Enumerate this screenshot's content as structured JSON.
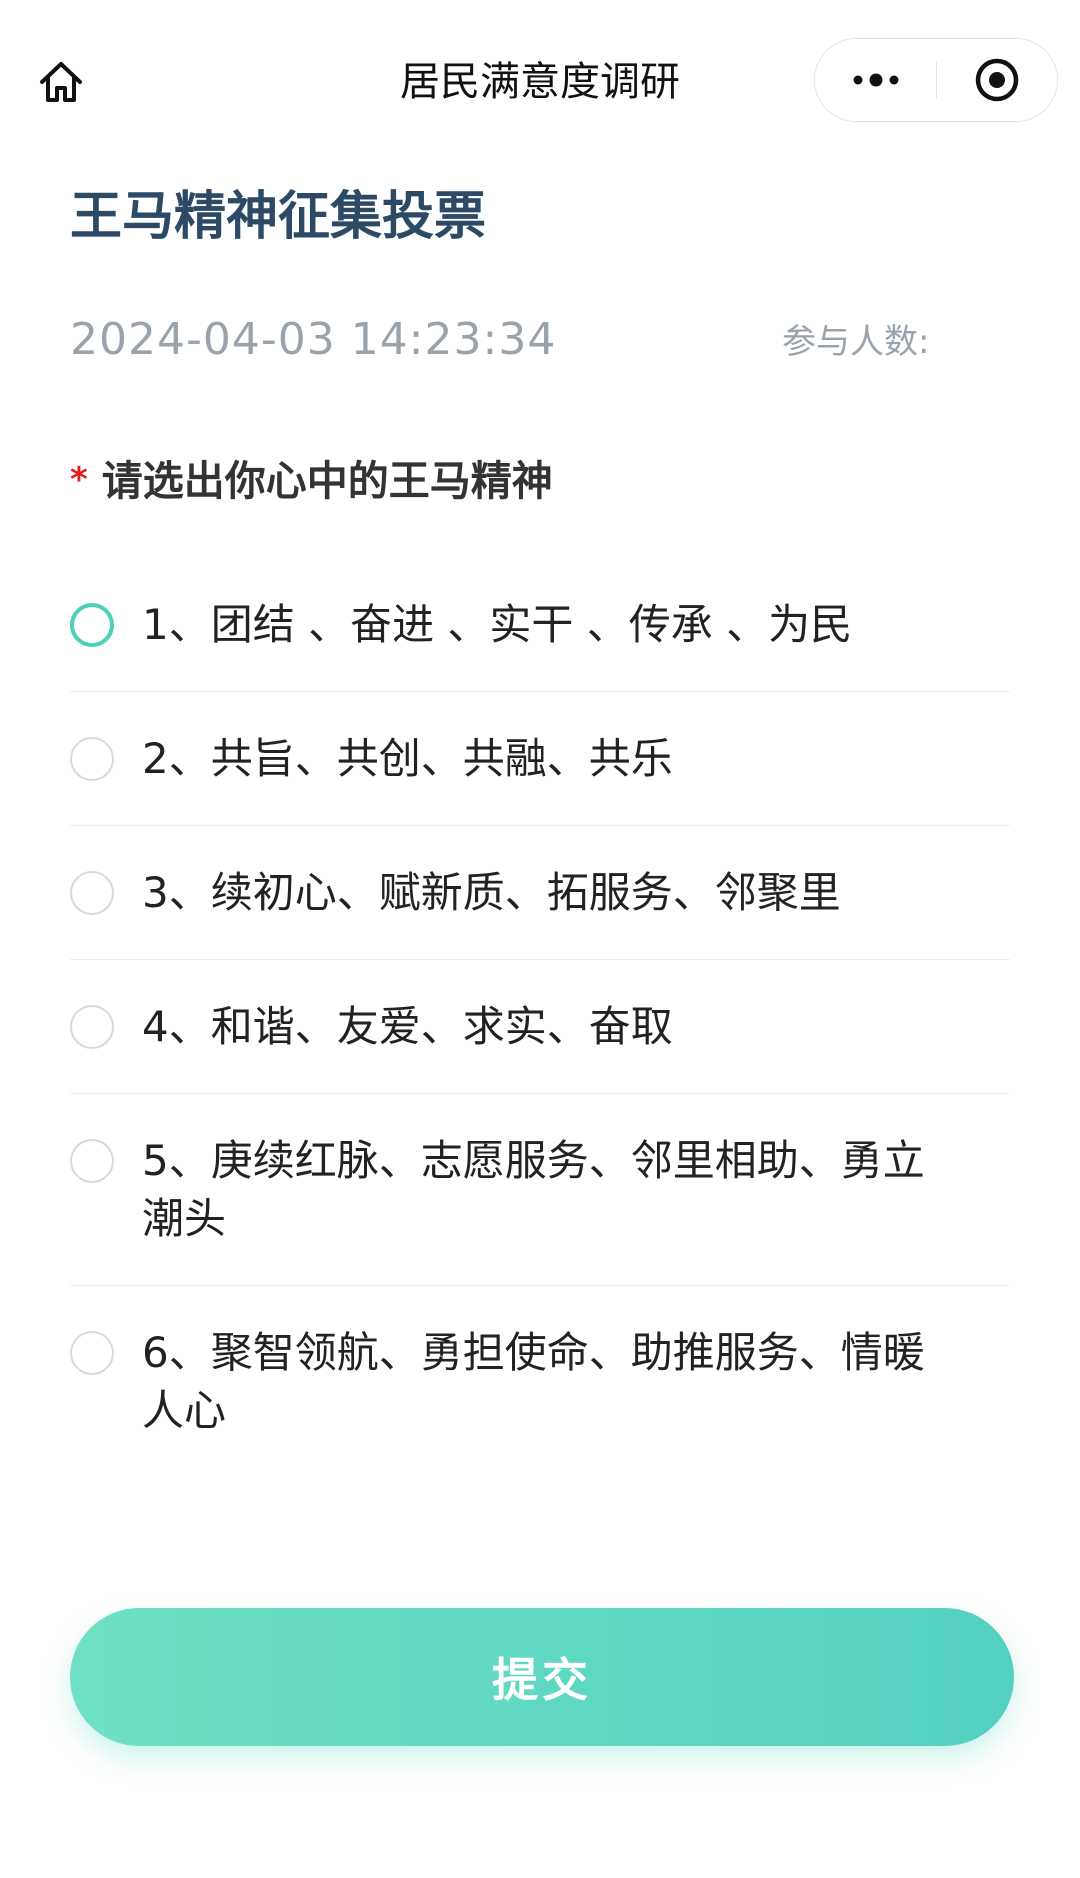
{
  "navbar": {
    "title": "居民满意度调研",
    "home_icon": "home-icon",
    "more_icon": "more-dots-icon",
    "close_icon": "miniprogram-close-icon"
  },
  "survey": {
    "title": "王马精神征集投票",
    "timestamp": "2024-04-03 14:23:34",
    "participants_label": "参与人数:"
  },
  "question": {
    "required_mark": "*",
    "text": "请选出你心中的王马精神",
    "options": [
      {
        "label": "1、团结 、奋进 、实干 、传承 、为民",
        "state": "focused"
      },
      {
        "label": "2、共旨、共创、共融、共乐",
        "state": "unselected"
      },
      {
        "label": "3、续初心、赋新质、拓服务、邻聚里",
        "state": "unselected"
      },
      {
        "label": "4、和谐、友爱、求实、奋取",
        "state": "unselected"
      },
      {
        "label": "5、庚续红脉、志愿服务、邻里相助、勇立潮头",
        "state": "unselected"
      },
      {
        "label": "6、聚智领航、勇担使命、助推服务、情暖人心",
        "state": "unselected"
      }
    ]
  },
  "submit": {
    "label": "提交"
  },
  "colors": {
    "accent": "#5dd7c1",
    "title": "#2c4a66",
    "muted": "#9aa3ab",
    "required": "#e02020"
  }
}
